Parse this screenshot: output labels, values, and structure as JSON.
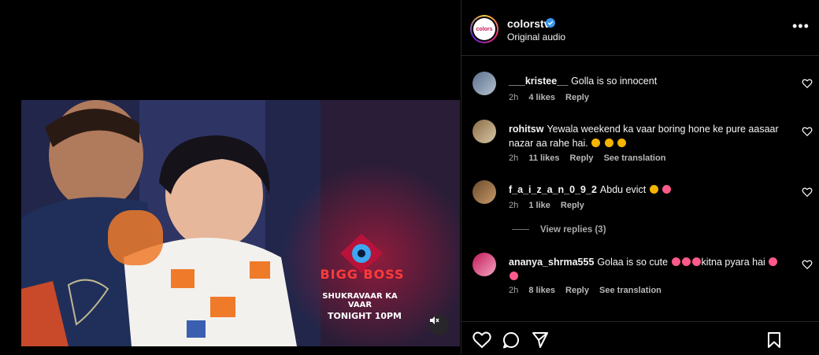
{
  "post": {
    "username": "colorstv",
    "avatar_text": "colors",
    "audio": "Original audio",
    "more_label": "•••",
    "verified_color": "#3897f0"
  },
  "video": {
    "show_title": "BIGG BOSS",
    "subtitle": "SHUKRAVAAR KA VAAR",
    "time": "TONIGHT 10PM",
    "muted": true
  },
  "comments": [
    {
      "user": "___kristee__",
      "text": "Golla is so innocent",
      "time": "2h",
      "likes": "4 likes",
      "reply": "Reply",
      "translate": "",
      "emojis": []
    },
    {
      "user": "rohitsw",
      "text": "Yewala weekend ka vaar boring hone ke pure aasaar nazar aa rahe hai.",
      "time": "2h",
      "likes": "11 likes",
      "reply": "Reply",
      "translate": "See translation",
      "emojis": [
        "sad",
        "sad",
        "sad"
      ]
    },
    {
      "user": "f_a_i_z_a_n_0_9_2",
      "text": "Abdu evict",
      "time": "2h",
      "likes": "1 like",
      "reply": "Reply",
      "translate": "",
      "emojis": [
        "sad",
        "cry"
      ]
    },
    {
      "user": "ananya_shrma555",
      "text_a": "Golaa is so cute",
      "text_b": "kitna pyara hai",
      "time": "2h",
      "likes": "8 likes",
      "reply": "Reply",
      "translate": "See translation",
      "emojis": [
        "heart-eyes",
        "heart-eyes",
        "heart-eyes",
        "heart-eyes",
        "heart-eyes"
      ]
    }
  ],
  "view_replies": "View replies (3)",
  "colors": {
    "background": "#000000",
    "muted_text": "#a8a8a8",
    "divider": "#262626"
  },
  "icons": [
    "heart-icon",
    "comment-icon",
    "share-icon",
    "bookmark-icon",
    "mute-icon",
    "verified-icon",
    "more-icon"
  ]
}
